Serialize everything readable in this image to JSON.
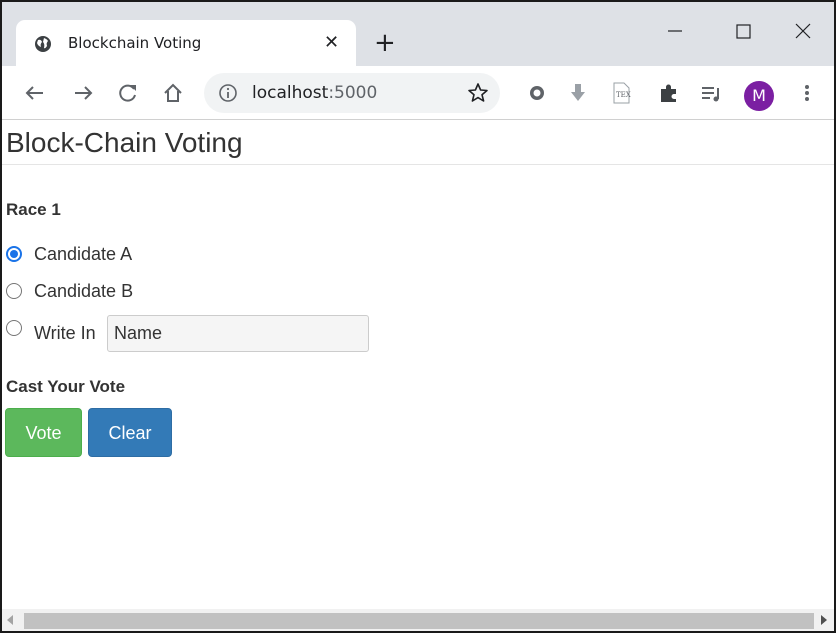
{
  "browser": {
    "tab": {
      "title": "Blockchain Voting",
      "close_glyph": "✕",
      "favicon": "globe-icon"
    },
    "new_tab_glyph": "+",
    "address": {
      "host": "localhost",
      "port": ":5000"
    },
    "profile_initial": "M",
    "extensions": [
      "record-icon",
      "download-icon",
      "tex-icon",
      "puzzle-icon",
      "reading-list-icon"
    ],
    "colors": {
      "tabstrip": "#dee1e6",
      "avatar": "#7b1fa2"
    }
  },
  "page": {
    "title": "Block-Chain Voting",
    "race_label": "Race 1",
    "options": [
      {
        "label": "Candidate A",
        "checked": true
      },
      {
        "label": "Candidate B",
        "checked": false
      },
      {
        "label": "Write In",
        "checked": false
      }
    ],
    "write_in_value": "Name",
    "cast_label": "Cast Your Vote",
    "buttons": {
      "vote": "Vote",
      "clear": "Clear"
    },
    "colors": {
      "vote": "#5cb85c",
      "clear": "#337ab7",
      "radio_checked": "#1a73e8"
    }
  }
}
